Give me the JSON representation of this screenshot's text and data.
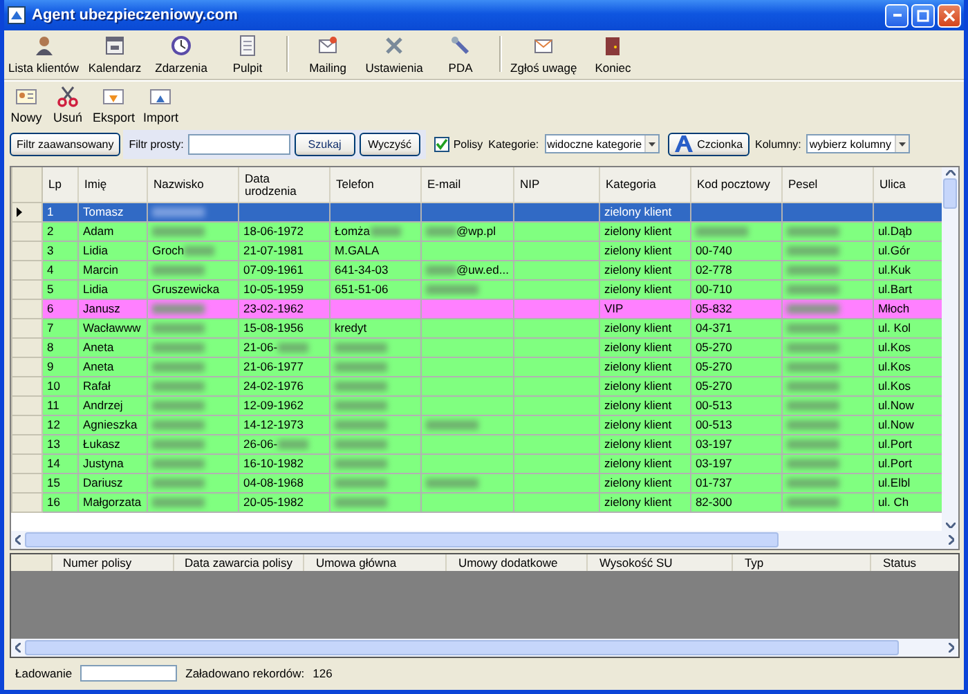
{
  "window": {
    "title": "Agent ubezpieczeniowy.com"
  },
  "toolbar": [
    [
      {
        "label": "Lista klientów"
      },
      {
        "label": "Kalendarz"
      },
      {
        "label": "Zdarzenia"
      },
      {
        "label": "Pulpit"
      }
    ],
    [
      {
        "label": "Mailing"
      },
      {
        "label": "Ustawienia"
      },
      {
        "label": "PDA"
      }
    ],
    [
      {
        "label": "Zgłoś uwagę"
      },
      {
        "label": "Koniec"
      }
    ]
  ],
  "actions": [
    {
      "label": "Nowy"
    },
    {
      "label": "Usuń"
    },
    {
      "label": "Eksport"
    },
    {
      "label": "Import"
    }
  ],
  "filter": {
    "advanced_button": "Filtr zaawansowany",
    "simple_label": "Filtr prosty:",
    "search_button": "Szukaj",
    "clear_button": "Wyczyść",
    "policies": {
      "label": "Polisy",
      "checked": true
    },
    "categories_label": "Kategorie:",
    "categories_value": "widoczne kategorie",
    "font_button": "Czcionka",
    "columns_label": "Kolumny:",
    "columns_value": "wybierz kolumny"
  },
  "table": {
    "columns": [
      "Lp",
      "Imię",
      "Nazwisko",
      "Data urodzenia",
      "Telefon",
      "E-mail",
      "NIP",
      "Kategoria",
      "Kod pocztowy",
      "Pesel",
      "Ulica"
    ],
    "rows": [
      {
        "selected": true,
        "color": "#316ac5",
        "cells": [
          "1",
          "Tomasz",
          {
            "blurred": true
          },
          null,
          null,
          null,
          null,
          "zielony klient",
          null,
          null,
          null
        ]
      },
      {
        "selected": false,
        "color": "#80ff80",
        "cells": [
          "2",
          "Adam",
          {
            "blurred": true
          },
          "18-06-1972",
          {
            "text": "Łomża",
            "blurred": true
          },
          {
            "blurred": true,
            "text_after": "@wp.pl"
          },
          null,
          "zielony klient",
          {
            "blurred": true
          },
          {
            "blurred": true
          },
          "ul.Dąb"
        ]
      },
      {
        "selected": false,
        "color": "#80ff80",
        "cells": [
          "3",
          "Lidia",
          {
            "text": "Groch",
            "blurred": true
          },
          "21-07-1981",
          "M.GALA",
          null,
          null,
          "zielony klient",
          "00-740",
          {
            "blurred": true
          },
          "ul.Gór"
        ]
      },
      {
        "selected": false,
        "color": "#80ff80",
        "cells": [
          "4",
          "Marcin",
          {
            "blurred": true
          },
          "07-09-1961",
          "641-34-03",
          {
            "blurred": true,
            "text_after": "@uw.ed..."
          },
          null,
          "zielony klient",
          "02-778",
          {
            "blurred": true
          },
          "ul.Kuk"
        ]
      },
      {
        "selected": false,
        "color": "#80ff80",
        "cells": [
          "5",
          "Lidia",
          "Gruszewicka",
          "10-05-1959",
          "651-51-06",
          {
            "blurred": true
          },
          null,
          "zielony klient",
          "00-710",
          {
            "blurred": true
          },
          "ul.Bart"
        ]
      },
      {
        "selected": false,
        "color": "#ff80ff",
        "cells": [
          "6",
          "Janusz",
          {
            "blurred": true
          },
          "23-02-1962",
          null,
          null,
          null,
          "VIP",
          "05-832",
          {
            "blurred": true
          },
          "Młoch"
        ]
      },
      {
        "selected": false,
        "color": "#80ff80",
        "cells": [
          "7",
          "Wacławww",
          {
            "blurred": true
          },
          "15-08-1956",
          "kredyt",
          null,
          null,
          "zielony klient",
          "04-371",
          {
            "blurred": true
          },
          "ul. Kol"
        ]
      },
      {
        "selected": false,
        "color": "#80ff80",
        "cells": [
          "8",
          "Aneta",
          {
            "blurred": true
          },
          {
            "text": "21-06-",
            "blurred": true
          },
          {
            "blurred": true
          },
          null,
          null,
          "zielony klient",
          "05-270",
          {
            "blurred": true
          },
          "ul.Kos"
        ]
      },
      {
        "selected": false,
        "color": "#80ff80",
        "cells": [
          "9",
          "Aneta",
          {
            "blurred": true
          },
          "21-06-1977",
          {
            "blurred": true
          },
          null,
          null,
          "zielony klient",
          "05-270",
          {
            "blurred": true
          },
          "ul.Kos"
        ]
      },
      {
        "selected": false,
        "color": "#80ff80",
        "cells": [
          "10",
          "Rafał",
          {
            "blurred": true
          },
          "24-02-1976",
          {
            "blurred": true
          },
          null,
          null,
          "zielony klient",
          "05-270",
          {
            "blurred": true
          },
          "ul.Kos"
        ]
      },
      {
        "selected": false,
        "color": "#80ff80",
        "cells": [
          "11",
          "Andrzej",
          {
            "blurred": true
          },
          "12-09-1962",
          {
            "blurred": true
          },
          null,
          null,
          "zielony klient",
          "00-513",
          {
            "blurred": true
          },
          "ul.Now"
        ]
      },
      {
        "selected": false,
        "color": "#80ff80",
        "cells": [
          "12",
          "Agnieszka",
          {
            "blurred": true
          },
          "14-12-1973",
          {
            "blurred": true
          },
          {
            "blurred": true
          },
          null,
          "zielony klient",
          "00-513",
          {
            "blurred": true
          },
          "ul.Now"
        ]
      },
      {
        "selected": false,
        "color": "#80ff80",
        "cells": [
          "13",
          "Łukasz",
          {
            "blurred": true
          },
          {
            "text": "26-06-",
            "blurred": true
          },
          {
            "blurred": true
          },
          null,
          null,
          "zielony klient",
          "03-197",
          {
            "blurred": true
          },
          "ul.Port"
        ]
      },
      {
        "selected": false,
        "color": "#80ff80",
        "cells": [
          "14",
          "Justyna",
          {
            "blurred": true
          },
          "16-10-1982",
          {
            "blurred": true
          },
          null,
          null,
          "zielony klient",
          "03-197",
          {
            "blurred": true
          },
          "ul.Port"
        ]
      },
      {
        "selected": false,
        "color": "#80ff80",
        "cells": [
          "15",
          "Dariusz",
          {
            "blurred": true
          },
          "04-08-1968",
          {
            "blurred": true
          },
          {
            "blurred": true
          },
          null,
          "zielony klient",
          "01-737",
          {
            "blurred": true
          },
          "ul.Elbl"
        ]
      },
      {
        "selected": false,
        "color": "#80ff80",
        "cells": [
          "16",
          "Małgorzata",
          {
            "blurred": true
          },
          "20-05-1982",
          {
            "blurred": true
          },
          null,
          null,
          "zielony klient",
          "82-300",
          {
            "blurred": true
          },
          "ul. Ch"
        ]
      }
    ]
  },
  "policies_table": {
    "columns": [
      "Numer polisy",
      "Data zawarcia polisy",
      "Umowa główna",
      "Umowy dodatkowe",
      "Wysokość SU",
      "Typ",
      "Status"
    ]
  },
  "status_bar": {
    "loading_label": "Ładowanie",
    "loading": {
      "level": 0
    },
    "loaded_label": "Załadowano rekordów:",
    "loaded_count": "126"
  }
}
